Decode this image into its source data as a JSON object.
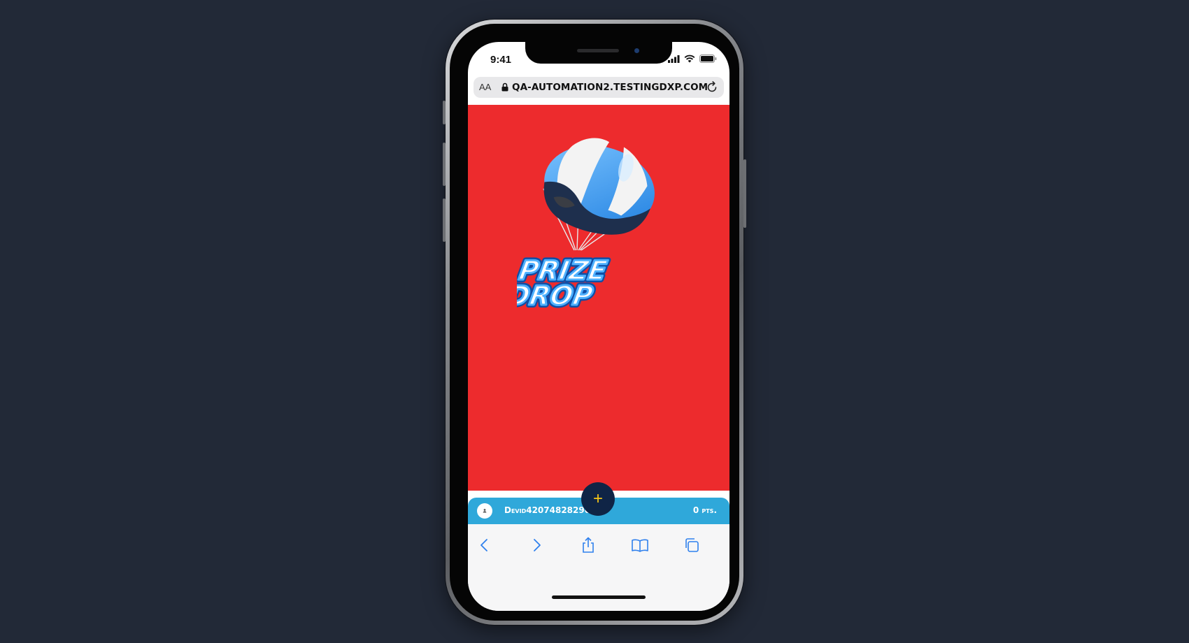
{
  "status_bar": {
    "time": "9:41"
  },
  "browser": {
    "text_size_label": "AA",
    "url": "QA-AUTOMATION2.TESTINGDXP.COM"
  },
  "page": {
    "background_color": "#ed2b2d",
    "logo": {
      "line1": "PRIZE",
      "line2": "DROP"
    },
    "fab_label": "+"
  },
  "user_bar": {
    "username": "Devid42074828290",
    "points": "0 pts.",
    "accent_color": "#2fa8da"
  },
  "toolbar": {
    "items": [
      "back-icon",
      "forward-icon",
      "share-icon",
      "bookmarks-icon",
      "tabs-icon"
    ]
  }
}
